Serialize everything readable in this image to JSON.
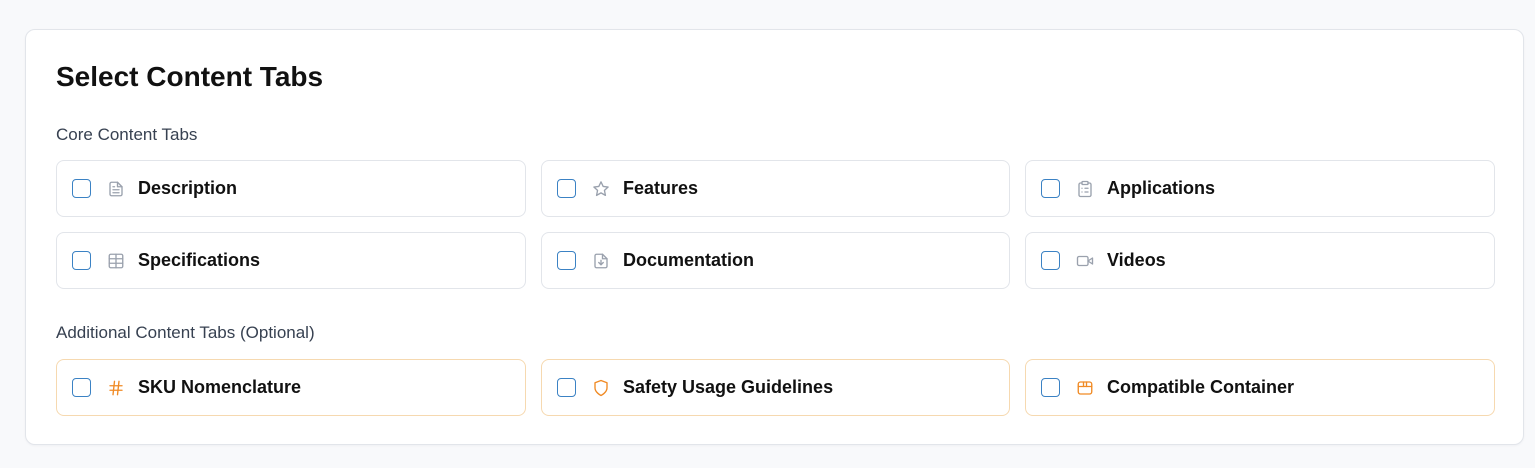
{
  "title": "Select Content Tabs",
  "core": {
    "label": "Core Content Tabs",
    "items": [
      {
        "label": "Description",
        "icon": "file-text-icon"
      },
      {
        "label": "Features",
        "icon": "star-icon"
      },
      {
        "label": "Applications",
        "icon": "clipboard-icon"
      },
      {
        "label": "Specifications",
        "icon": "table-icon"
      },
      {
        "label": "Documentation",
        "icon": "file-download-icon"
      },
      {
        "label": "Videos",
        "icon": "video-icon"
      }
    ]
  },
  "additional": {
    "label": "Additional Content Tabs (Optional)",
    "items": [
      {
        "label": "SKU Nomenclature",
        "icon": "hash-icon"
      },
      {
        "label": "Safety Usage Guidelines",
        "icon": "shield-icon"
      },
      {
        "label": "Compatible Container",
        "icon": "container-icon"
      }
    ]
  },
  "colors": {
    "core_icon": "#9aa1ad",
    "optional_icon": "#f08a24",
    "checkbox_border": "#3b82c4",
    "optional_border": "#f6d9b0"
  }
}
